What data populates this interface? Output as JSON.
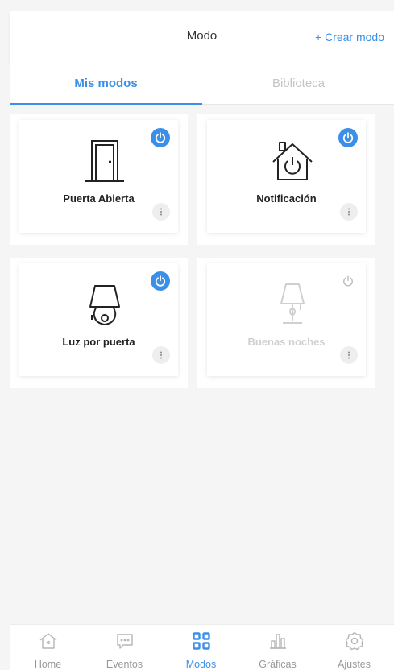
{
  "header": {
    "title": "Modo",
    "create_label": "+ Crear modo"
  },
  "tabs": [
    {
      "label": "Mis modos",
      "active": true
    },
    {
      "label": "Biblioteca",
      "active": false
    }
  ],
  "modes": [
    {
      "label": "Puerta Abierta",
      "icon": "door-icon",
      "enabled": true
    },
    {
      "label": "Notificación",
      "icon": "smart-home-icon",
      "enabled": true
    },
    {
      "label": "Luz por puerta",
      "icon": "lamp-icon",
      "enabled": true
    },
    {
      "label": "Buenas noches",
      "icon": "floor-lamp-icon",
      "enabled": false
    }
  ],
  "nav": [
    {
      "label": "Home",
      "icon": "home-icon",
      "active": false
    },
    {
      "label": "Eventos",
      "icon": "chat-icon",
      "active": false
    },
    {
      "label": "Modos",
      "icon": "grid-icon",
      "active": true
    },
    {
      "label": "Gráficas",
      "icon": "bar-chart-icon",
      "active": false
    },
    {
      "label": "Ajustes",
      "icon": "settings-icon",
      "active": false
    }
  ],
  "colors": {
    "accent": "#3b8fe6",
    "inactive": "#999999",
    "disabled": "#d0d0d0",
    "background": "#f5f5f5"
  }
}
